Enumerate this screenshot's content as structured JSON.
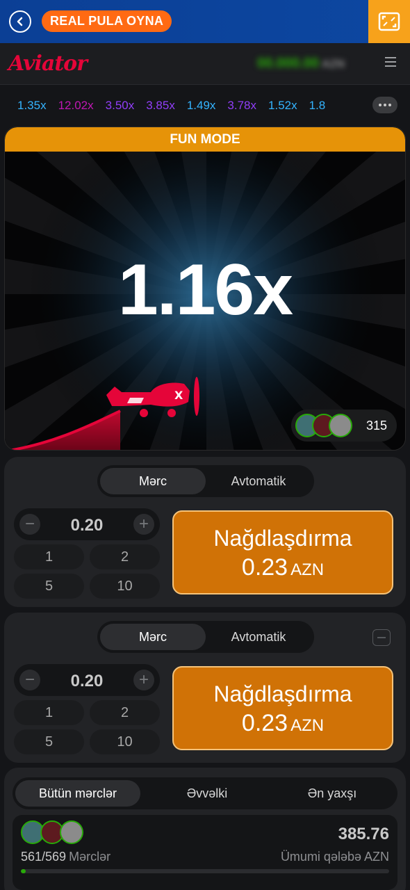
{
  "topbar": {
    "back_icon": "chevron-left-icon",
    "real_button": "REAL PULA OYNA",
    "fullscreen_icon": "fullscreen-icon"
  },
  "header": {
    "logo": "Aviator",
    "balance": "00.000.00",
    "balance_currency": "AZN",
    "menu_icon": "hamburger-menu-icon"
  },
  "history": {
    "items": [
      {
        "value": "1.35x",
        "color": "#34b4ff"
      },
      {
        "value": "12.02x",
        "color": "#c017b4"
      },
      {
        "value": "3.50x",
        "color": "#913ef8"
      },
      {
        "value": "3.85x",
        "color": "#913ef8"
      },
      {
        "value": "1.49x",
        "color": "#34b4ff"
      },
      {
        "value": "3.78x",
        "color": "#913ef8"
      },
      {
        "value": "1.52x",
        "color": "#34b4ff"
      },
      {
        "value": "1.8",
        "color": "#34b4ff"
      }
    ],
    "more_icon": "more-dots-icon"
  },
  "game": {
    "mode_banner": "FUN MODE",
    "multiplier": "1.16x",
    "players_count": "315"
  },
  "bet_panels": [
    {
      "tabs": [
        "Mərc",
        "Avtomatik"
      ],
      "stake": "0.20",
      "quick_amounts": [
        "1",
        "2",
        "5",
        "10"
      ],
      "cashout_label": "Nağdlaşdırma",
      "cashout_amount": "0.23",
      "cashout_currency": "AZN"
    },
    {
      "tabs": [
        "Mərc",
        "Avtomatik"
      ],
      "stake": "0.20",
      "quick_amounts": [
        "1",
        "2",
        "5",
        "10"
      ],
      "cashout_label": "Nağdlaşdırma",
      "cashout_amount": "0.23",
      "cashout_currency": "AZN"
    }
  ],
  "bets": {
    "tabs": [
      "Bütün mərclər",
      "Əvvəlki",
      "Ən yaxşı"
    ],
    "count": "561/569",
    "count_label": "Mərclər",
    "total": "385.76",
    "total_label": "Ümumi qələbə AZN",
    "progress": 0.014
  },
  "colors": {
    "accent_orange": "#d07206",
    "fun_mode": "#e69308",
    "brand_red": "#e50539",
    "topbar_blue": "#0d47a1"
  }
}
